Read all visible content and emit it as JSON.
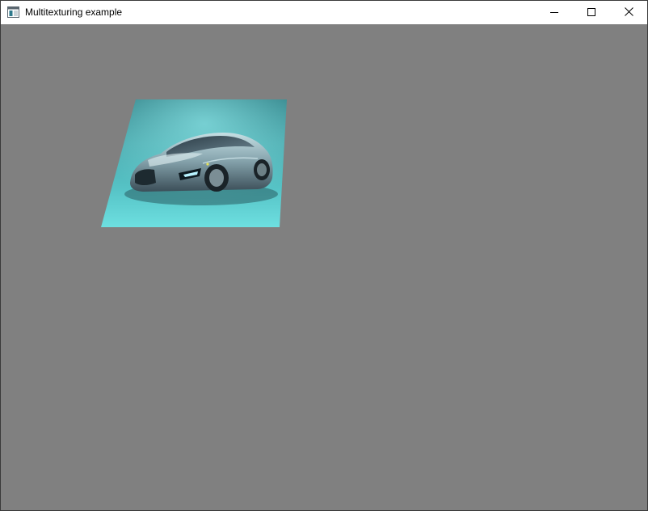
{
  "window": {
    "title": "Multitexturing example",
    "icon": "qt-window-icon",
    "controls": {
      "minimize_icon": "minimize-icon",
      "maximize_icon": "maximize-icon",
      "close_icon": "close-icon"
    }
  },
  "viewport": {
    "background_color": "#808080",
    "textured_quad": {
      "texture_subject": "silver sports car",
      "tint_color": "#5fd6d6"
    }
  }
}
